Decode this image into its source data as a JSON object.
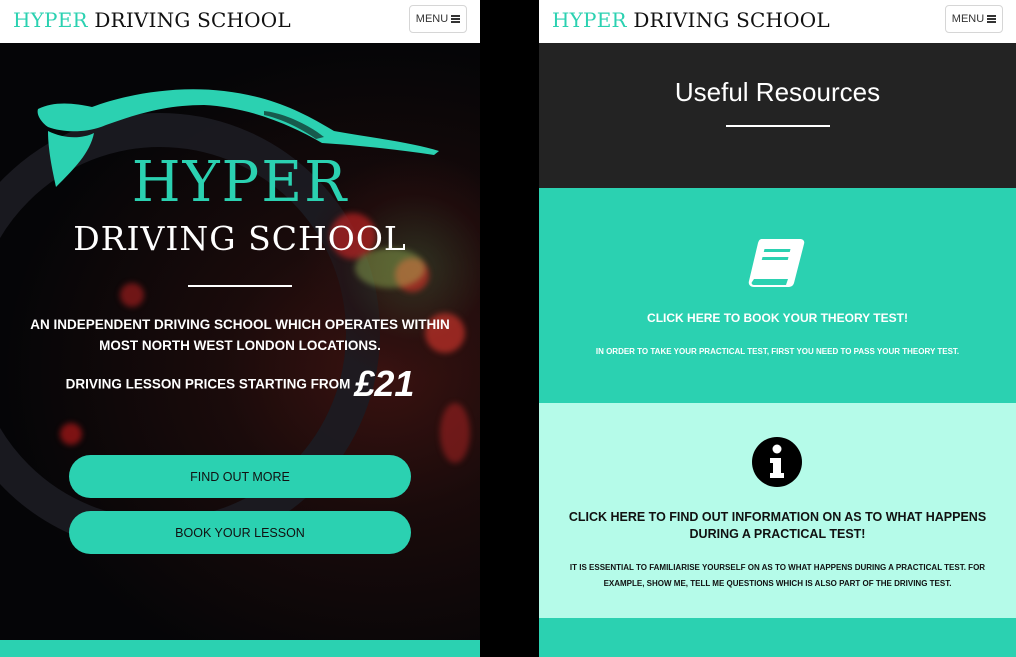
{
  "brand": {
    "hyper": "HYPER",
    "rest": " DRIVING SCHOOL"
  },
  "nav": {
    "menu_label": "MENU"
  },
  "hero": {
    "logo_hyper": "HYPER",
    "logo_driving": "DRIVING SCHOOL",
    "tagline": "AN INDEPENDENT DRIVING SCHOOL WHICH OPERATES WITHIN MOST NORTH WEST LONDON LOCATIONS.",
    "price_label": "DRIVING LESSON PRICES STARTING FROM",
    "price_amount": "£21",
    "btn_find_out": "FIND OUT MORE",
    "btn_book": "BOOK YOUR LESSON"
  },
  "resources": {
    "title": "Useful Resources",
    "cards": [
      {
        "icon": "book-icon",
        "title": "CLICK HERE TO BOOK YOUR THEORY TEST!",
        "text": "IN ORDER TO TAKE YOUR PRACTICAL TEST, FIRST YOU NEED TO PASS YOUR THEORY TEST."
      },
      {
        "icon": "info-icon",
        "title": "CLICK HERE TO FIND OUT INFORMATION ON AS TO WHAT HAPPENS DURING A PRACTICAL TEST!",
        "text": "IT IS ESSENTIAL TO FAMILIARISE YOURSELF ON AS TO WHAT HAPPENS DURING A PRACTICAL TEST. FOR EXAMPLE, SHOW ME, TELL ME QUESTIONS WHICH IS ALSO PART OF THE DRIVING TEST."
      }
    ]
  },
  "colors": {
    "accent": "#2bd1b1",
    "light_accent": "#b5fbe9",
    "dark": "#232323"
  }
}
